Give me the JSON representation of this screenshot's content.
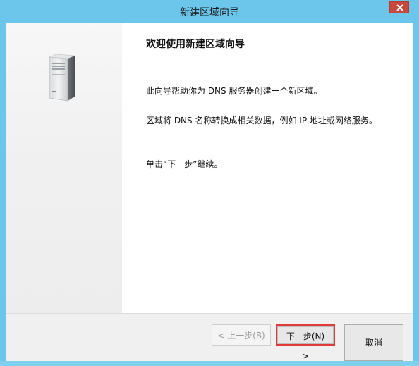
{
  "window": {
    "title": "新建区域向导",
    "close_icon": "close-icon"
  },
  "content": {
    "heading": "欢迎使用新建区域向导",
    "paragraph1": "此向导帮助你为 DNS 服务器创建一个新区域。",
    "paragraph2": "区域将 DNS 名称转换成相关数据，例如 IP 地址或网络服务。",
    "paragraph3": "单击“下一步”继续。"
  },
  "buttons": {
    "back_label": "< 上一步(B)",
    "next_label": "下一步(N) >",
    "cancel_label": "取消"
  },
  "colors": {
    "titlebar": "#6cc6ec",
    "close": "#c9483c",
    "highlight": "#e03b3b"
  }
}
